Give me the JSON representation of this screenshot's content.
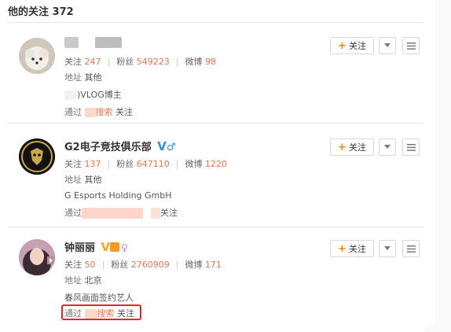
{
  "header": {
    "title": "他的关注 372"
  },
  "labels": {
    "follow_count": "关注",
    "fans": "粉丝",
    "weibo": "微博",
    "address": "地址",
    "via": "通过",
    "search": "搜索",
    "follow_suffix": "关注"
  },
  "follow_button": "关注",
  "users": [
    {
      "name": "",
      "follow": "247",
      "fans": "549223",
      "weibo": "98",
      "address": "其他",
      "bio": ")VLOG博主",
      "via_link": "搜索",
      "via_suffix": "关注"
    },
    {
      "name": "G2电子竞技俱乐部",
      "follow": "137",
      "fans": "647110",
      "weibo": "1220",
      "address": "其他",
      "bio": "G Esports Holding GmbH",
      "via_suffix": "关注"
    },
    {
      "name": "钟丽丽",
      "follow": "50",
      "fans": "2760909",
      "weibo": "171",
      "address": "北京",
      "bio": "春风画面签约艺人",
      "via_link": "搜索",
      "via_suffix": "关注"
    }
  ],
  "colors": {
    "accent": "#eb7350",
    "verified_blue": "#2f8ef4",
    "verified_gold": "#f5a623",
    "highlight_red": "#e0282d"
  }
}
